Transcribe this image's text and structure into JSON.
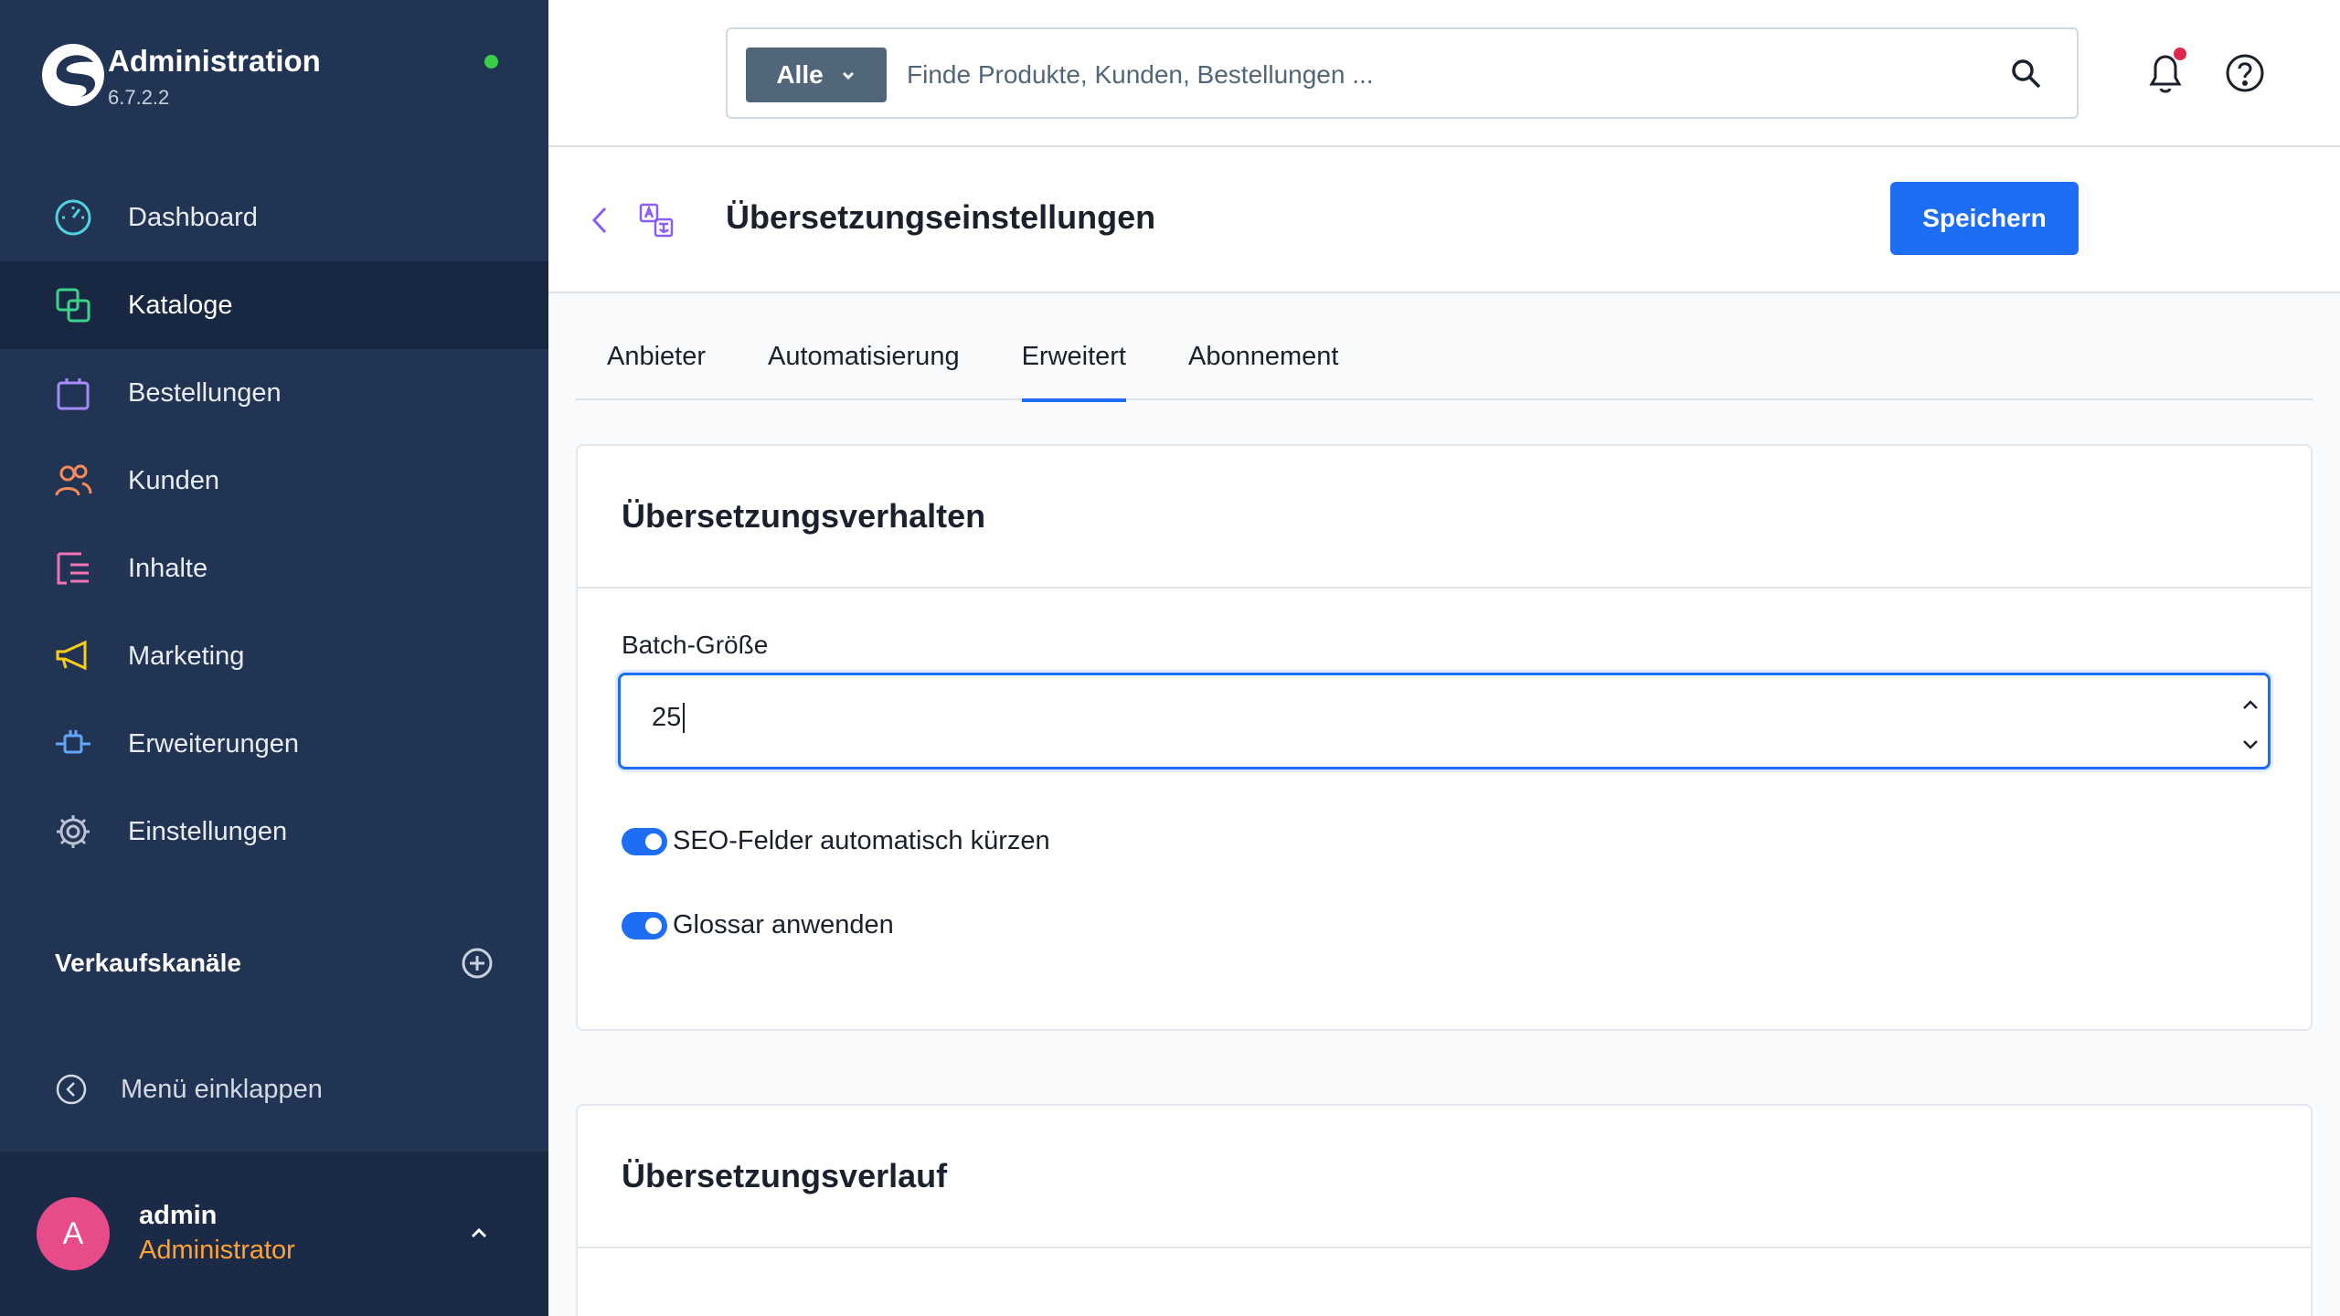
{
  "brand": {
    "title": "Administration",
    "version": "6.7.2.2"
  },
  "nav": [
    {
      "label": "Dashboard",
      "icon": "dashboard-icon"
    },
    {
      "label": "Kataloge",
      "icon": "catalog-icon",
      "active": true
    },
    {
      "label": "Bestellungen",
      "icon": "orders-icon"
    },
    {
      "label": "Kunden",
      "icon": "customers-icon"
    },
    {
      "label": "Inhalte",
      "icon": "content-icon"
    },
    {
      "label": "Marketing",
      "icon": "marketing-icon"
    },
    {
      "label": "Erweiterungen",
      "icon": "extensions-icon"
    },
    {
      "label": "Einstellungen",
      "icon": "settings-icon"
    }
  ],
  "channels": {
    "label": "Verkaufskanäle"
  },
  "collapse": {
    "label": "Menü einklappen"
  },
  "user": {
    "initial": "A",
    "name": "admin",
    "role": "Administrator"
  },
  "search": {
    "filter": "Alle",
    "placeholder": "Finde Produkte, Kunden, Bestellungen ..."
  },
  "page": {
    "title": "Übersetzungseinstellungen",
    "save": "Speichern"
  },
  "tabs": [
    {
      "label": "Anbieter"
    },
    {
      "label": "Automatisierung"
    },
    {
      "label": "Erweitert",
      "active": true
    },
    {
      "label": "Abonnement"
    }
  ],
  "behavior": {
    "title": "Übersetzungsverhalten",
    "batch_label": "Batch-Größe",
    "batch_value": "25",
    "toggles": [
      {
        "label": "SEO-Felder automatisch kürzen",
        "on": true
      },
      {
        "label": "Glossar anwenden",
        "on": true
      }
    ]
  },
  "history": {
    "title": "Übersetzungsverlauf"
  },
  "colors": {
    "sidebar": "#223453",
    "accent": "#1e6ef4",
    "status": "#37d046",
    "role": "#ffa235",
    "avatar": "#e74b8a"
  }
}
